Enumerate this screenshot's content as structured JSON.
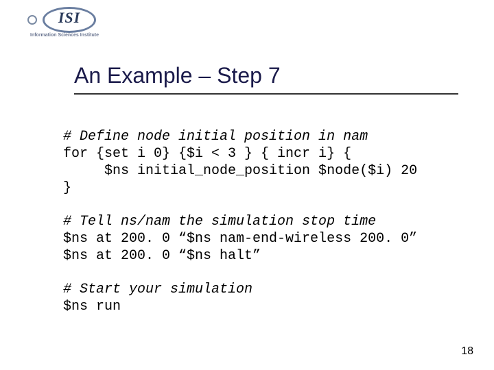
{
  "logo": {
    "acronym": "ISI",
    "subtitle": "Information Sciences Institute"
  },
  "title": "An Example – Step 7",
  "code": {
    "block1": {
      "comment": "# Define node initial position in nam",
      "line1": "for {set i 0} {$i < 3 } { incr i} {",
      "line2": "     $ns initial_node_position $node($i) 20",
      "line3": "}"
    },
    "block2": {
      "comment": "# Tell ns/nam the simulation stop time",
      "line1": "$ns at 200. 0 “$ns nam-end-wireless 200. 0”",
      "line2": "$ns at 200. 0 “$ns halt”"
    },
    "block3": {
      "comment": "# Start your simulation",
      "line1": "$ns run"
    }
  },
  "page_number": "18"
}
